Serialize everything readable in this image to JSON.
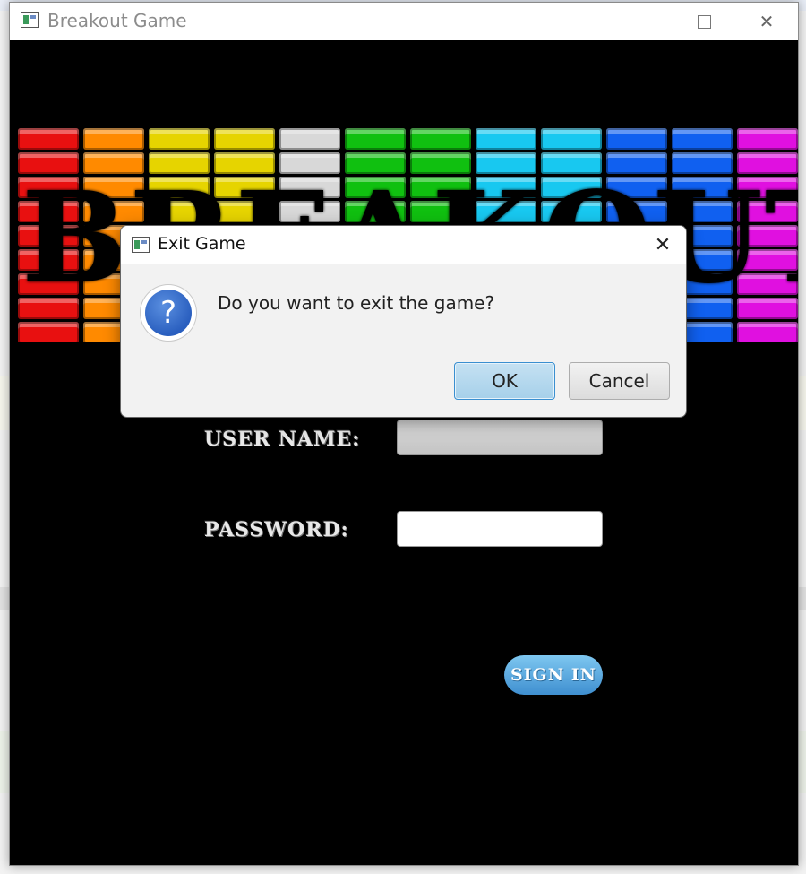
{
  "window": {
    "title": "Breakout Game",
    "logo_text": "BREAKOUT",
    "brick_colors": [
      "#e81010",
      "#ff8a00",
      "#e6d400",
      "#e6d400",
      "#d8d8d8",
      "#10c010",
      "#10c010",
      "#18c8f0",
      "#18c8f0",
      "#1060f0",
      "#1060f0",
      "#e010e0"
    ]
  },
  "login": {
    "username_label": "USER NAME:",
    "password_label": "PASSWORD:",
    "signin_label": "SIGN IN",
    "username_value": "",
    "password_value": ""
  },
  "dialog": {
    "title": "Exit Game",
    "message": "Do you want to exit the game?",
    "ok_label": "OK",
    "cancel_label": "Cancel",
    "close_glyph": "✕",
    "question_glyph": "?"
  },
  "colors": {
    "ok_button": "#a6d0ea",
    "signin_button": "#3f8fd0"
  }
}
